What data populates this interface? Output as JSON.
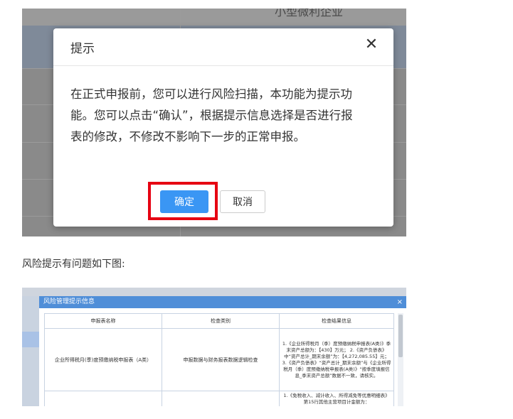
{
  "screenshot1": {
    "background_partial_text": "小型微利企业",
    "dialog": {
      "title": "提示",
      "close_icon": "close-icon",
      "message": "在正式申报前，您可以进行风险扫描，本功能为提示功能。您可以点击“确认”，根据提示信息选择是否进行报表的修改，不修改不影响下一步的正常申报。",
      "confirm_label": "确定",
      "cancel_label": "取消"
    },
    "colors": {
      "confirm": "#3a96f4",
      "highlight": "#e60012"
    }
  },
  "caption": "风险提示有问题如下图:",
  "screenshot2": {
    "window_title": "风险管理提示信息",
    "close_label": "×",
    "table": {
      "headers": [
        "申报表名称",
        "检查类别",
        "检查结果信息"
      ],
      "rows": [
        {
          "name": "企业所得税月(季)度预缴纳税申报表（A类）",
          "category": "申报数据与财务报表数据逻辑检查",
          "result": "1.《企业所得税月（季）度预缴纳税申报表(A类)》季末资产总额为：【430】万元； 2.《资产负债表》中“资产总计_期末余额”为：【4,272,085.55】元； 3.《资产负债表》“资产总计_期末余额”与《企业所得税月（季）度预缴纳税申报表(A类)》“按季度填报信息_季末资产总额”数据不一致，请核实。"
        },
        {
          "name": "",
          "category": "",
          "result": "1.《免税收入、减计收入、所得减免等优惠明细表》第15行其他主营项目计金额为："
        }
      ]
    }
  }
}
